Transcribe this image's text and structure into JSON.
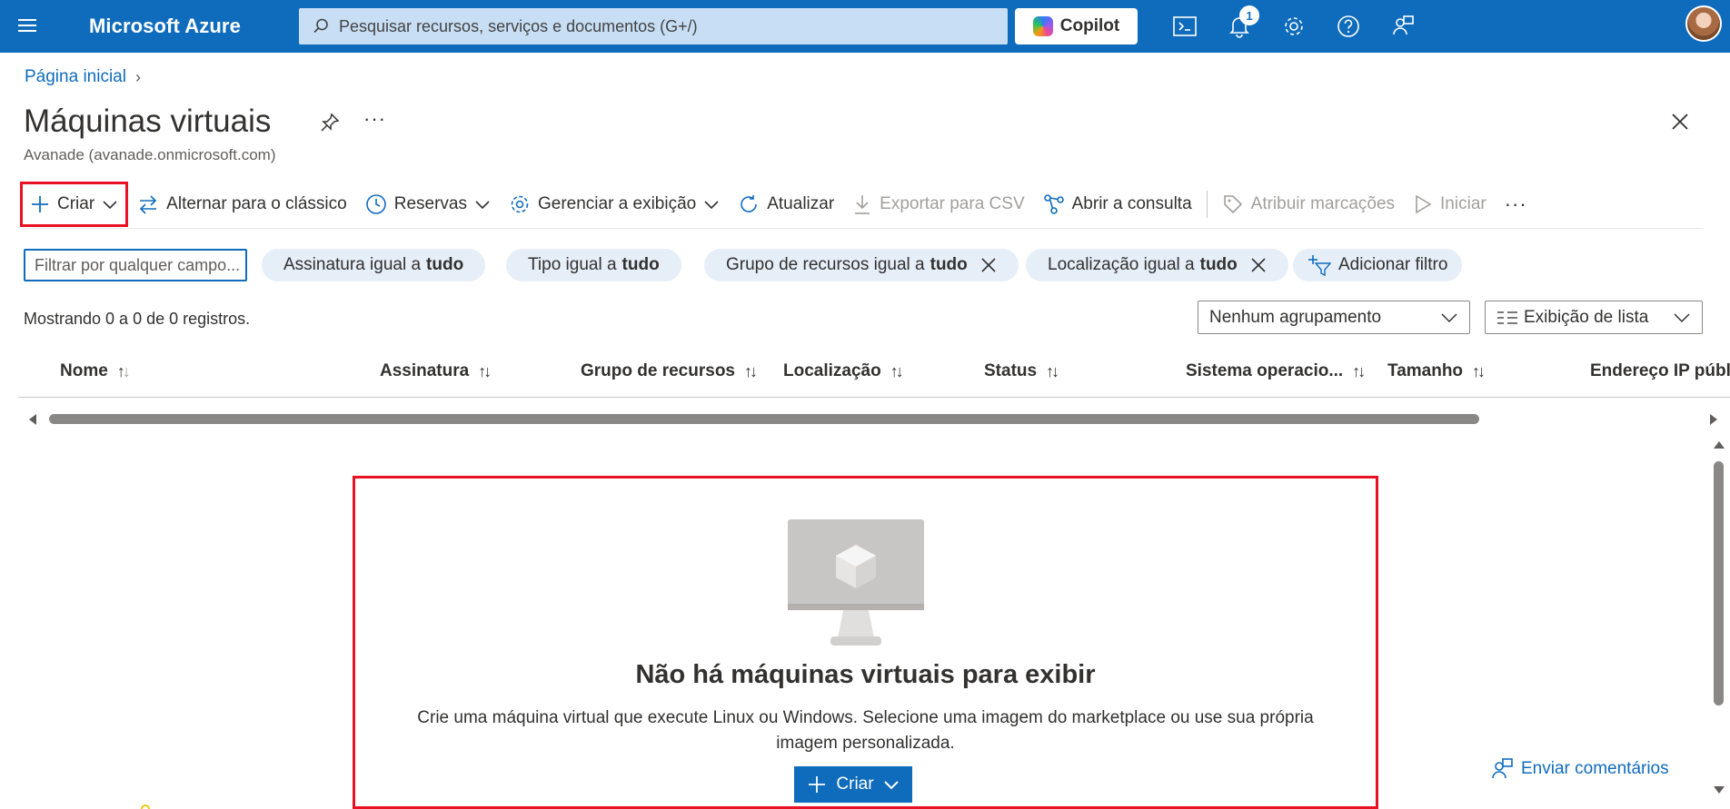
{
  "header": {
    "brand": "Microsoft Azure",
    "search_placeholder": "Pesquisar recursos, serviços e documentos (G+/)",
    "copilot_label": "Copilot",
    "notification_count": "1"
  },
  "breadcrumb": {
    "home": "Página inicial"
  },
  "page": {
    "title": "Máquinas virtuais",
    "subtitle": "Avanade (avanade.onmicrosoft.com)"
  },
  "toolbar": {
    "create": "Criar",
    "switch_classic": "Alternar para o clássico",
    "reservations": "Reservas",
    "manage_view": "Gerenciar a exibição",
    "refresh": "Atualizar",
    "export_csv": "Exportar para CSV",
    "open_query": "Abrir a consulta",
    "assign_tags": "Atribuir marcações",
    "start": "Iniciar"
  },
  "filters": {
    "input_placeholder": "Filtrar por qualquer campo...",
    "pills": [
      {
        "label": "Assinatura igual a",
        "value": "tudo"
      },
      {
        "label": "Tipo igual a",
        "value": "tudo"
      },
      {
        "label": "Grupo de recursos igual a",
        "value": "tudo"
      },
      {
        "label": "Localização igual a",
        "value": "tudo"
      }
    ],
    "add_filter": "Adicionar filtro"
  },
  "records_text": "Mostrando 0 a 0 de 0 registros.",
  "grouping": "Nenhum agrupamento",
  "view_mode": "Exibição de lista",
  "columns": [
    "Nome",
    "Assinatura",
    "Grupo de recursos",
    "Localização",
    "Status",
    "Sistema operacio...",
    "Tamanho",
    "Endereço IP públi"
  ],
  "empty_state": {
    "title": "Não há máquinas virtuais para exibir",
    "description": "Crie uma máquina virtual que execute Linux ou Windows. Selecione uma imagem do marketplace ou use sua própria imagem personalizada.",
    "create": "Criar"
  },
  "feedback": "Enviar comentários",
  "colors": {
    "brand": "#0f6cbd",
    "highlight": "#e81123",
    "pill_bg": "#e6eef8"
  }
}
